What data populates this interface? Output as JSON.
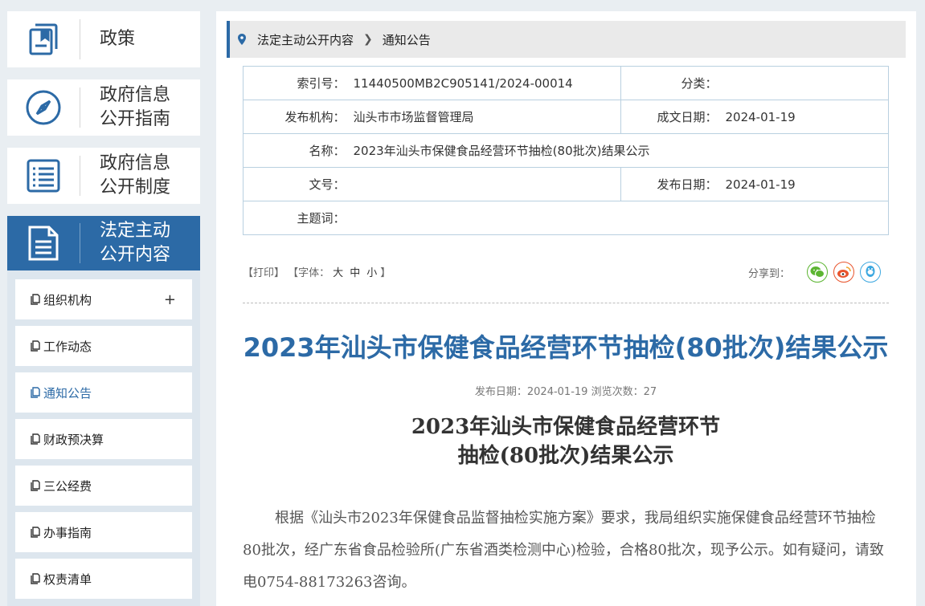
{
  "sidebar": {
    "big_items": [
      {
        "label": "政策",
        "icon": "book-icon"
      },
      {
        "label": "政府信息\n公开指南",
        "icon": "compass-icon"
      },
      {
        "label": "政府信息\n公开制度",
        "icon": "list-document-icon"
      },
      {
        "label": "法定主动\n公开内容",
        "icon": "document-icon"
      }
    ],
    "sub_items": [
      {
        "label": "组织机构",
        "expand": "+"
      },
      {
        "label": "工作动态"
      },
      {
        "label": "通知公告"
      },
      {
        "label": "财政预决算"
      },
      {
        "label": "三公经费"
      },
      {
        "label": "办事指南"
      },
      {
        "label": "权责清单"
      }
    ]
  },
  "breadcrumb": {
    "items": [
      "法定主动公开内容",
      "通知公告"
    ]
  },
  "meta": {
    "index_label": "索引号：",
    "index_value": "11440500MB2C905141/2024-00014",
    "category_label": "分类：",
    "category_value": "",
    "publisher_label": "发布机构：",
    "publisher_value": "汕头市市场监督管理局",
    "created_label": "成文日期：",
    "created_value": "2024-01-19",
    "name_label": "名称：",
    "name_value": "2023年汕头市保健食品经营环节抽检(80批次)结果公示",
    "docno_label": "文号：",
    "docno_value": "",
    "published_label": "发布日期：",
    "published_value": "2024-01-19",
    "keywords_label": "主题词：",
    "keywords_value": ""
  },
  "toolbar": {
    "print": "【打印】",
    "font_prefix": "【字体：",
    "font_large": "大",
    "font_medium": "中",
    "font_small": "小",
    "font_suffix": "】",
    "share_label": "分享到："
  },
  "article": {
    "title": "2023年汕头市保健食品经营环节抽检(80批次)结果公示",
    "date_label": "发布日期：",
    "date_value": "2024-01-19",
    "views_label": "浏览次数：",
    "views_value": "27",
    "doc_title": "2023年汕头市保健食品经营环节\n抽检(80批次)结果公示",
    "body": "根据《汕头市2023年保健食品监督抽检实施方案》要求，我局组织实施保健食品经营环节抽检80批次，经广东省食品检验所(广东省酒类检测中心)检验，合格80批次，现予公示。如有疑问，请致电0754-88173263咨询。"
  },
  "colors": {
    "accent": "#2c6aa6",
    "wechat": "#5cb531",
    "weibo": "#e8542d",
    "qq": "#3da8e0"
  }
}
